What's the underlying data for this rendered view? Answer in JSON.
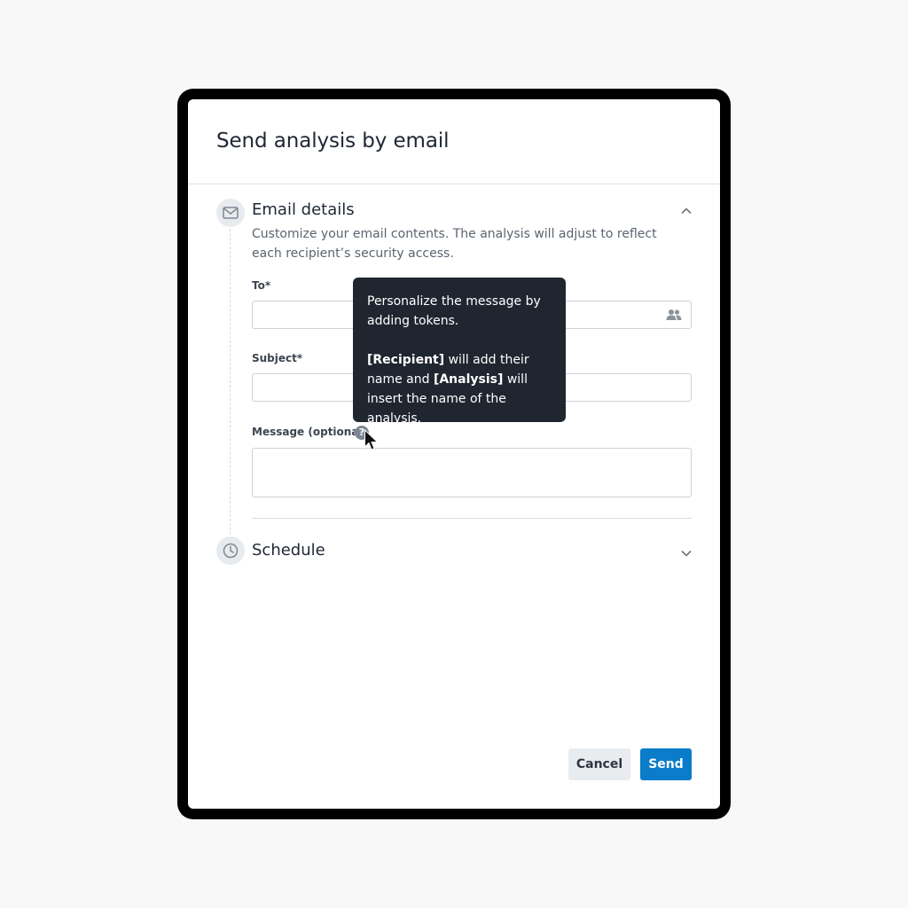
{
  "modal": {
    "title": "Send analysis by email",
    "cancel_label": "Cancel",
    "send_label": "Send"
  },
  "email_section": {
    "title": "Email details",
    "description": "Customize your email contents. The analysis will adjust to reflect each recipient’s security access.",
    "icon": "mail-icon",
    "expanded": true,
    "fields": {
      "to_label": "To*",
      "to_value": "",
      "subject_label": "Subject*",
      "subject_value": "",
      "message_label": "Message (optional)",
      "message_value": "",
      "help_glyph": "?"
    }
  },
  "schedule_section": {
    "title": "Schedule",
    "icon": "clock-icon",
    "expanded": false
  },
  "tooltip": {
    "line1": "Personalize the message by adding tokens.",
    "token_recipient": "[Recipient]",
    "text_mid": " will add their name and ",
    "token_analysis": "[Analysis]",
    "text_end": " will insert the name of the analysis."
  },
  "colors": {
    "primary": "#0a7cc9",
    "tooltip_bg": "#1f2630",
    "frame": "#000000",
    "page_bg": "#f8f8f8"
  }
}
